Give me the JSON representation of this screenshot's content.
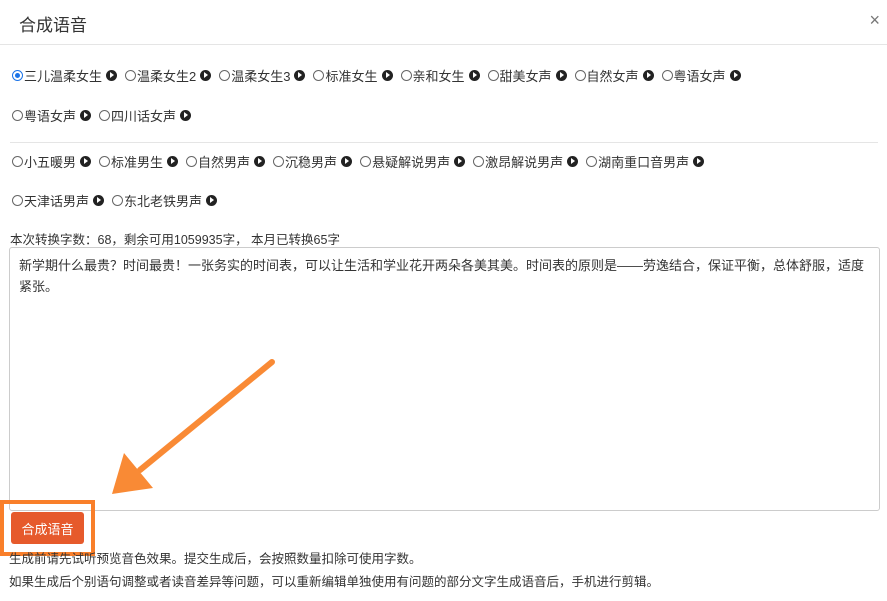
{
  "dialog": {
    "title": "合成语音",
    "close_symbol": "×"
  },
  "female_voices_row1": [
    {
      "label": "三儿温柔女生",
      "checked": true
    },
    {
      "label": "温柔女生2",
      "checked": false
    },
    {
      "label": "温柔女生3",
      "checked": false
    },
    {
      "label": "标准女生",
      "checked": false
    },
    {
      "label": "亲和女生",
      "checked": false
    },
    {
      "label": "甜美女声",
      "checked": false
    },
    {
      "label": "自然女声",
      "checked": false
    },
    {
      "label": "粤语女声",
      "checked": false
    }
  ],
  "female_voices_row2": [
    {
      "label": "粤语女声",
      "checked": false
    },
    {
      "label": "四川话女声",
      "checked": false
    }
  ],
  "male_voices_row1": [
    {
      "label": "小五暖男",
      "checked": false
    },
    {
      "label": "标准男生",
      "checked": false
    },
    {
      "label": "自然男声",
      "checked": false
    },
    {
      "label": "沉稳男声",
      "checked": false
    },
    {
      "label": "悬疑解说男声",
      "checked": false
    },
    {
      "label": "激昂解说男声",
      "checked": false
    },
    {
      "label": "湖南重口音男声",
      "checked": false
    }
  ],
  "male_voices_row2": [
    {
      "label": "天津话男声",
      "checked": false
    },
    {
      "label": "东北老铁男声",
      "checked": false
    }
  ],
  "stats_text": "本次转换字数：68，剩余可用1059935字， 本月已转换65字",
  "text_content": "新学期什么最贵？时间最贵！一张务实的时间表，可以让生活和学业花开两朵各美其美。时间表的原则是——劳逸结合，保证平衡，总体舒服，适度紧张。",
  "generate_button": "合成语音",
  "notes": [
    "生成前请先试听预览音色效果。提交生成后，会按照数量扣除可使用字数。",
    "如果生成后个别语句调整或者读音差异等问题，可以重新编辑单独使用有问题的部分文字生成语音后，手机进行剪辑。"
  ],
  "colors": {
    "accent_button": "#e65a2c",
    "highlight_border": "#f97f2a",
    "arrow": "#f98a35",
    "radio_selected": "#1a73e8"
  }
}
